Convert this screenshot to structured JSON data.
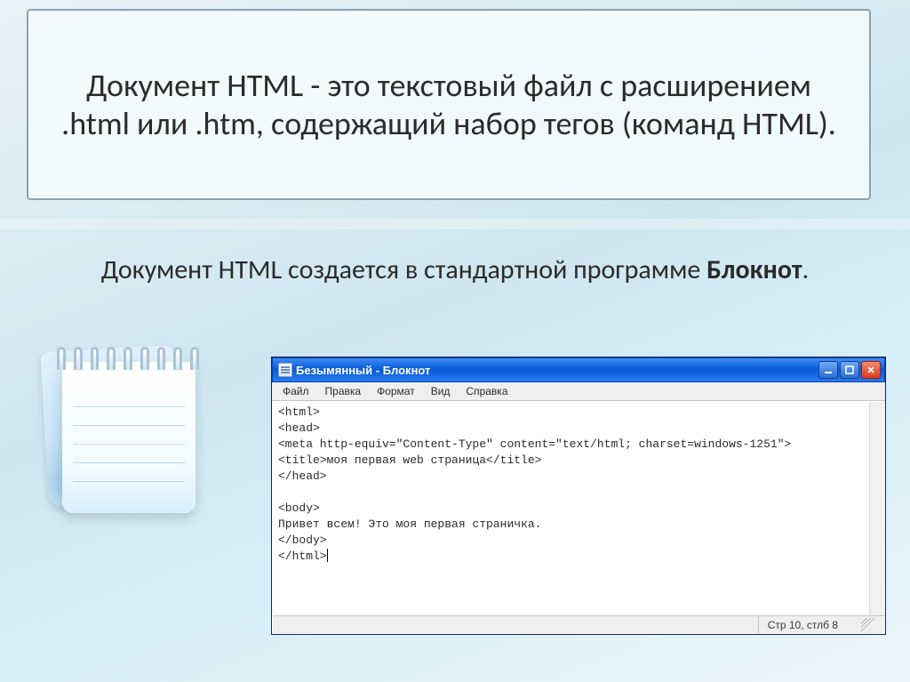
{
  "title_text": "Документ HTML - это текстовый файл с расширением .html или .htm, содержащий набор тегов (команд HTML).",
  "subtitle_pre": "Документ HTML создается в стандартной программе ",
  "subtitle_bold": "Блокнот",
  "subtitle_post": ".",
  "notepad": {
    "window_title": "Безымянный - Блокнот",
    "menu": {
      "file": "Файл",
      "edit": "Правка",
      "format": "Формат",
      "view": "Вид",
      "help": "Справка"
    },
    "content_lines": [
      "<html>",
      "<head>",
      "<meta http-equiv=\"Content-Type\" content=\"text/html; charset=windows-1251\">",
      "<title>моя первая web страница</title>",
      "</head>",
      "",
      "<body>",
      "Привет всем! Это моя первая страничка.",
      "</body>",
      "</html>"
    ],
    "status": "Стр 10, стлб 8"
  },
  "icons": {
    "minimize": "minimize-icon",
    "maximize": "maximize-icon",
    "close": "close-icon"
  }
}
